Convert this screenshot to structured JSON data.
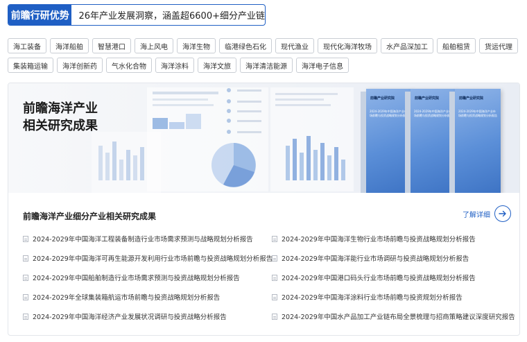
{
  "header": {
    "badge": "前瞻行研优势",
    "slogan": "26年产业发展洞察，涵盖超6600+细分产业链"
  },
  "tags": {
    "row1": [
      "海工装备",
      "海洋船舶",
      "智慧港口",
      "海上风电",
      "海洋生物",
      "临港绿色石化",
      "现代渔业",
      "现代化海洋牧场",
      "水产品深加工",
      "船舶租赁",
      "货运代理"
    ],
    "row2": [
      "集装箱运输",
      "海洋创新药",
      "气水化合物",
      "海洋涂料",
      "海洋文旅",
      "海洋清洁能源",
      "海洋电子信息"
    ]
  },
  "banner": {
    "title_line1": "前瞻海洋产业",
    "title_line2": "相关研究成果",
    "book_brand": "前瞻产业研究院",
    "book_title": "2024-2029年中国海洋产业市场前瞻与投资战略规划分析报告"
  },
  "section": {
    "title": "前瞻海洋产业细分产业相关研究成果",
    "more_label": "了解详细"
  },
  "reports": [
    "2024-2029年中国海洋工程装备制造行业市场需求预测与战略规划分析报告",
    "2024-2029年中国海洋生物行业市场前瞻与投资战略规划分析报告",
    "2024-2029年中国海洋可再生能源开发利用行业市场前瞻与投资战略规划分析报告",
    "2024-2029年中国海洋能行业市场调研与投资战略规划分析报告",
    "2024-2029年中国船舶制造行业市场需求预测与投资战略规划分析报告",
    "2024-2029年中国港口码头行业市场前瞻与投资战略规划分析报告",
    "2024-2029年全球集装箱航运市场前瞻与投资战略规划分析报告",
    "2024-2029年中国海洋涂料行业市场前瞻与投资规划分析报告",
    "2024-2029年中国海洋经济产业发展状况调研与投资战略分析报告",
    "2024-2029年中国水产品加工产业链布局全景梳理与招商策略建议深度研究报告"
  ],
  "colors": {
    "accent": "#1f5fc4"
  }
}
